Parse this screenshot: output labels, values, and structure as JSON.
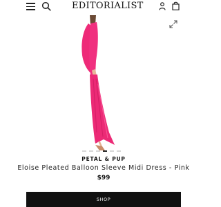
{
  "header": {
    "logo_text": "EDITORIALIST",
    "icons": [
      "menu-icon",
      "search-icon",
      "user-icon",
      "bag-icon"
    ]
  },
  "gallery": {
    "image_description_icon": "expand-icon",
    "dot_count": 6,
    "active_dot": 3
  },
  "product": {
    "brand": "PETAL & PUP",
    "name": "Eloise Pleated Balloon Sleeve Midi Dress - Pink",
    "price": "$99"
  },
  "cta": {
    "shop_label": "SHOP"
  },
  "colors": {
    "dress_pink": "#ee2a78",
    "button_black": "#111111",
    "text_dark": "#222222"
  }
}
